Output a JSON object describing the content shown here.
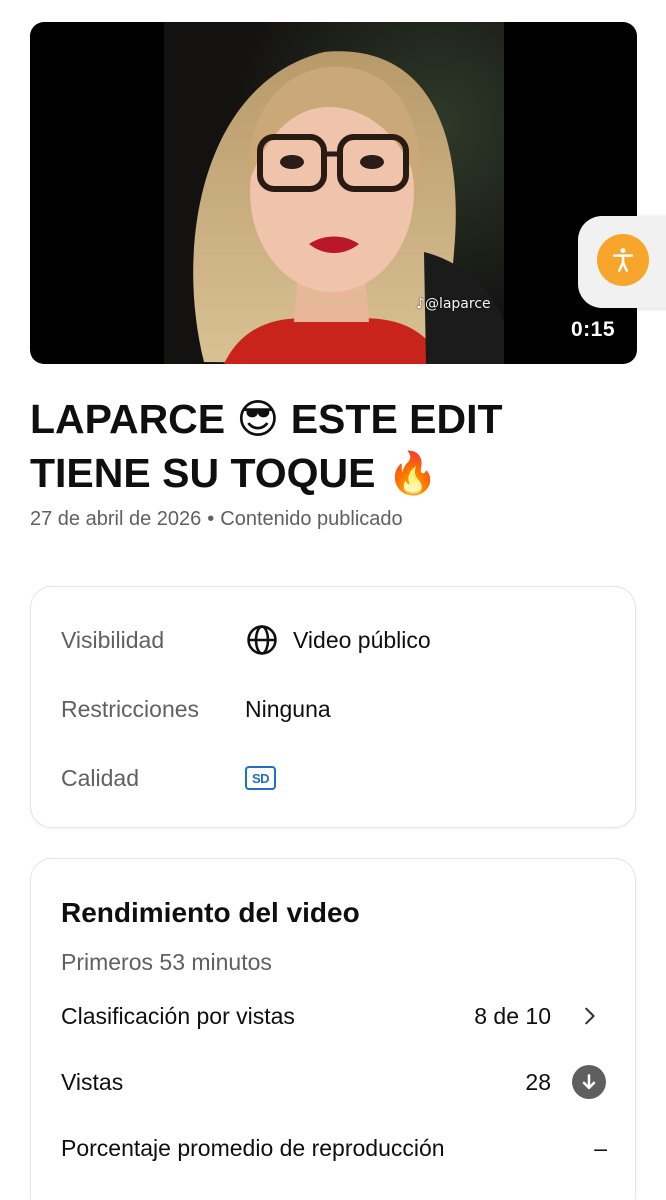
{
  "video": {
    "duration": "0:15",
    "watermark": "@laparce"
  },
  "title": {
    "line1_text": "LAPARCE",
    "line1_emoji": "😎",
    "line1_rest": "ESTE EDIT",
    "line2_text": "TIENE SU TOQUE",
    "line2_emoji": "🔥"
  },
  "meta": {
    "date": "27 de abril de 2026",
    "separator": "•",
    "status": "Contenido publicado"
  },
  "details": {
    "visibility_label": "Visibilidad",
    "visibility_value": "Video público",
    "restrictions_label": "Restricciones",
    "restrictions_value": "Ninguna",
    "quality_label": "Calidad",
    "quality_badge": "SD"
  },
  "performance": {
    "title": "Rendimiento del video",
    "subtitle": "Primeros 53 minutos",
    "ranking_label": "Clasificación por vistas",
    "ranking_value": "8 de 10",
    "views_label": "Vistas",
    "views_value": "28",
    "avg_label": "Porcentaje promedio de reproducción",
    "avg_value": "–"
  },
  "icons": {
    "accessibility": "accessibility-icon",
    "globe": "globe-icon",
    "chevron": "chevron-right-icon",
    "down_arrow": "arrow-down-icon"
  },
  "colors": {
    "accessibility_button": "#f7a52b",
    "sd_badge": "#1f6fc4"
  }
}
